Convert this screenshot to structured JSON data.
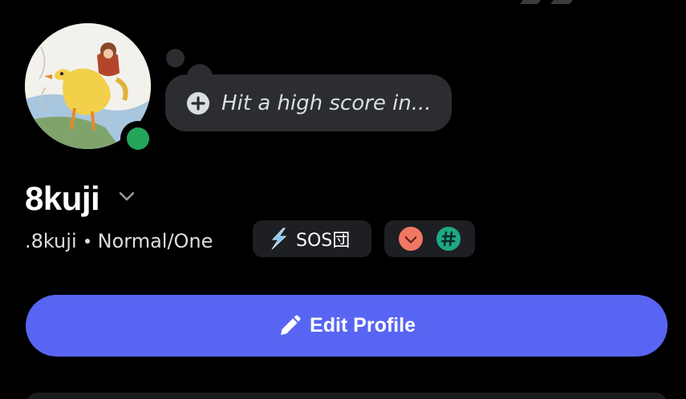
{
  "profile": {
    "display_name": "8kuji",
    "username": ".8kuji",
    "pronouns": "Normal/One",
    "status_placeholder": "Hit a high score in...",
    "online_status": "online"
  },
  "tag": {
    "icon": "lightning-bolt-icon",
    "label": "SOS団"
  },
  "badges": [
    {
      "icon": "chevron-down-badge-icon",
      "color": "#f07864"
    },
    {
      "icon": "hashtag-badge-icon",
      "color": "#1fa886"
    }
  ],
  "actions": {
    "edit_profile_label": "Edit Profile",
    "edit_profile_icon": "pencil-icon"
  },
  "colors": {
    "background": "#000000",
    "bubble": "#2b2d31",
    "chip": "#1e1f22",
    "accent": "#5865f2",
    "online": "#23a55a"
  }
}
